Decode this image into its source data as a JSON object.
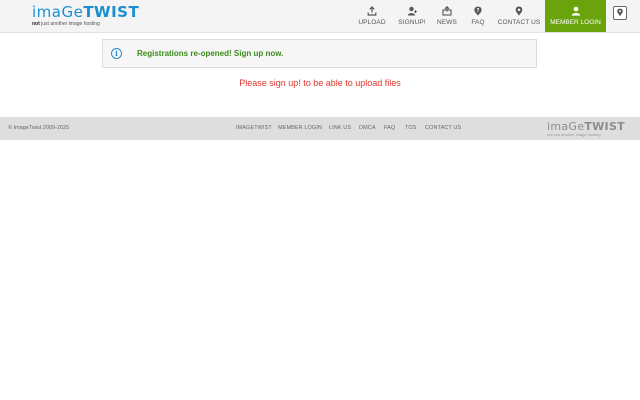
{
  "header": {
    "logo": {
      "part1": "imaGe",
      "part2": "TWIST",
      "tag_bold": "not",
      "tag_rest": " just another image hosting"
    },
    "nav": [
      {
        "label": "UPLOAD",
        "icon": "upload-icon"
      },
      {
        "label": "SIGNUP!",
        "icon": "add-user-icon"
      },
      {
        "label": "NEWS",
        "icon": "news-icon"
      },
      {
        "label": "FAQ",
        "icon": "question-icon"
      },
      {
        "label": "CONTACT US",
        "icon": "location-pin-icon"
      }
    ],
    "member_login": {
      "label": "MEMBER LOGIN",
      "icon": "user-icon"
    },
    "menu_icon": "map-pin-icon"
  },
  "alert": {
    "icon": "info-icon",
    "text": "Registrations re-opened! Sign up now."
  },
  "notice": "Please sign up! to be able to upload files",
  "footer": {
    "copyright": "© ImageTwist 2009-2025",
    "links": [
      "IMAGETWIST",
      "MEMBER LOGIN",
      "LINK US",
      "DMCA",
      "FAQ",
      "TOS",
      "CONTACT US"
    ],
    "logo": {
      "part1": "imaGe",
      "part2": "TWIST",
      "tag": "not just another image hosting"
    }
  },
  "colors": {
    "brand_blue": "#1a8fd0",
    "member_green": "#6aa40d",
    "alert_green": "#3a8c1a",
    "notice_red": "#e0342b",
    "footer_bg": "#dedede"
  }
}
